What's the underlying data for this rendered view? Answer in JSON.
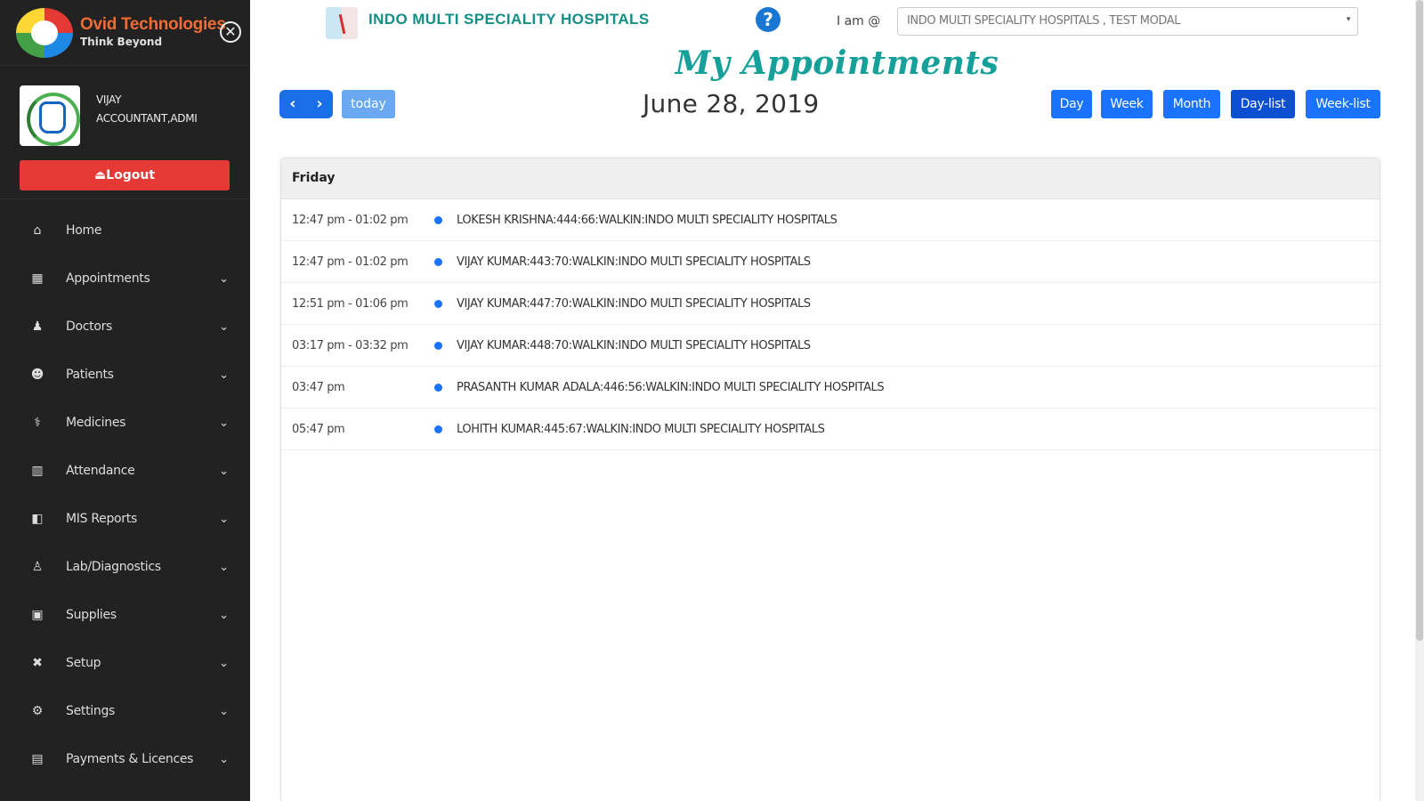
{
  "brand": {
    "name": "Ovid Technologies",
    "tagline": "Think Beyond",
    "close_symbol": "✕"
  },
  "user": {
    "name_line1": "VIJAY",
    "name_line2": "ACCOUNTANT,ADMI",
    "logout_label": "⏏Logout"
  },
  "sidebar": {
    "items": [
      {
        "label": "Home",
        "icon": "home-icon",
        "glyph": "⌂",
        "chevron": ""
      },
      {
        "label": "Appointments",
        "icon": "calendar-icon",
        "glyph": "▦",
        "chevron": "⌄"
      },
      {
        "label": "Doctors",
        "icon": "doctor-icon",
        "glyph": "♟",
        "chevron": "⌄"
      },
      {
        "label": "Patients",
        "icon": "patients-icon",
        "glyph": "☻",
        "chevron": "⌄"
      },
      {
        "label": "Medicines",
        "icon": "pills-icon",
        "glyph": "⚕",
        "chevron": "⌄"
      },
      {
        "label": "Attendance",
        "icon": "book-icon",
        "glyph": "▥",
        "chevron": "⌄"
      },
      {
        "label": "MIS Reports",
        "icon": "report-icon",
        "glyph": "◧",
        "chevron": "⌄"
      },
      {
        "label": "Lab/Diagnostics",
        "icon": "lab-icon",
        "glyph": "♙",
        "chevron": "⌄"
      },
      {
        "label": "Supplies",
        "icon": "box-icon",
        "glyph": "▣",
        "chevron": "⌄"
      },
      {
        "label": "Setup",
        "icon": "tools-icon",
        "glyph": "✖",
        "chevron": "⌄"
      },
      {
        "label": "Settings",
        "icon": "gear-icon",
        "glyph": "⚙",
        "chevron": "⌄"
      },
      {
        "label": "Payments & Licences",
        "icon": "receipt-icon",
        "glyph": "▤",
        "chevron": "⌄"
      }
    ]
  },
  "header": {
    "hospital_name": "INDO MULTI SPECIALITY HOSPITALS",
    "help_symbol": "?",
    "iam_label": "I am @",
    "selected_location": "INDO MULTI SPECIALITY HOSPITALS , TEST MODAL",
    "select_caret": "▾"
  },
  "page": {
    "title": "My Appointments"
  },
  "calendar": {
    "prev_symbol": "‹",
    "next_symbol": "›",
    "today_label": "today",
    "current_date": "June 28, 2019",
    "views": [
      {
        "label": "Day",
        "active": false
      },
      {
        "label": "Week",
        "active": false
      },
      {
        "label": "Month",
        "active": false
      },
      {
        "label": "Day-list",
        "active": true
      },
      {
        "label": "Week-list",
        "active": false
      }
    ],
    "day_header": "Friday",
    "appointments": [
      {
        "time": "12:47 pm - 01:02 pm",
        "title": "LOKESH KRISHNA:444:66:WALKIN:INDO MULTI SPECIALITY HOSPITALS"
      },
      {
        "time": "12:47 pm - 01:02 pm",
        "title": "VIJAY KUMAR:443:70:WALKIN:INDO MULTI SPECIALITY HOSPITALS"
      },
      {
        "time": "12:51 pm - 01:06 pm",
        "title": "VIJAY KUMAR:447:70:WALKIN:INDO MULTI SPECIALITY HOSPITALS"
      },
      {
        "time": "03:17 pm - 03:32 pm",
        "title": "VIJAY KUMAR:448:70:WALKIN:INDO MULTI SPECIALITY HOSPITALS"
      },
      {
        "time": "03:47 pm",
        "title": "PRASANTH KUMAR ADALA:446:56:WALKIN:INDO MULTI SPECIALITY HOSPITALS"
      },
      {
        "time": "05:47 pm",
        "title": "LOHITH KUMAR:445:67:WALKIN:INDO MULTI SPECIALITY HOSPITALS"
      }
    ]
  },
  "colors": {
    "sidebar_bg": "#222222",
    "accent_teal": "#15a09a",
    "primary_blue": "#1a73ff",
    "logout_red": "#e53935",
    "brand_orange": "#ef6c35"
  }
}
